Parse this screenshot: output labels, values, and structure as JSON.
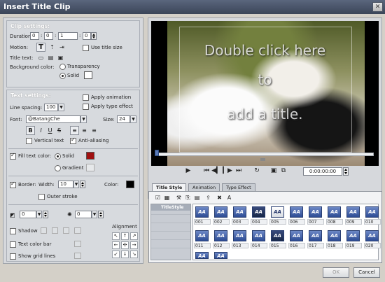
{
  "window": {
    "title": "Insert Title Clip",
    "close_glyph": "✕"
  },
  "clip": {
    "header": "Clip settings:",
    "duration_label": "Duration:",
    "duration": [
      "0",
      "0",
      "1",
      "0"
    ],
    "motion_label": "Motion:",
    "use_title_size": "Use title size",
    "title_text_label": "Title text:",
    "bg_color_label": "Background color:",
    "bg_transparency": "Transparency",
    "bg_solid": "Solid"
  },
  "text": {
    "header": "Text settings:",
    "apply_animation": "Apply animation",
    "apply_type_effect": "Apply type effect",
    "line_spacing_label": "Line spacing:",
    "line_spacing": "100",
    "font_label": "Font:",
    "font": "@BatangChe",
    "size_label": "Size:",
    "size": "24",
    "bold": "B",
    "italic": "I",
    "underline": "U",
    "strike": "S",
    "vertical_text": "Vertical text",
    "anti_aliasing": "Anti-aliasing",
    "fill_text_color": "Fill text color:",
    "fill_solid": "Solid",
    "fill_gradient": "Gradient",
    "fill_color": "#a01010",
    "border_label": "Border:",
    "width_label": "Width:",
    "border_width": "10",
    "color_label": "Color:",
    "border_color": "#000000",
    "outer_stroke": "Outer stroke",
    "shadow_offset": "0",
    "shadow_blur": "0",
    "shadow": "Shadow",
    "text_color_bar": "Text color bar",
    "show_grid_lines": "Show grid lines",
    "alignment": "Alignment"
  },
  "preview": {
    "overlay_lines": [
      "Double click here",
      "to",
      "add a title."
    ],
    "timecode": "0:00:00:00"
  },
  "style_panel": {
    "tabs": [
      "Title Style",
      "Animation",
      "Type Effect"
    ],
    "category": "TitleStyle",
    "thumb_glyph": "AA",
    "numbers": [
      "001",
      "002",
      "003",
      "004",
      "005",
      "006",
      "007",
      "008",
      "009",
      "010",
      "011",
      "012",
      "013",
      "014",
      "015",
      "016",
      "017",
      "018",
      "019",
      "020"
    ]
  },
  "dialog": {
    "ok": "OK",
    "cancel": "Cancel"
  }
}
